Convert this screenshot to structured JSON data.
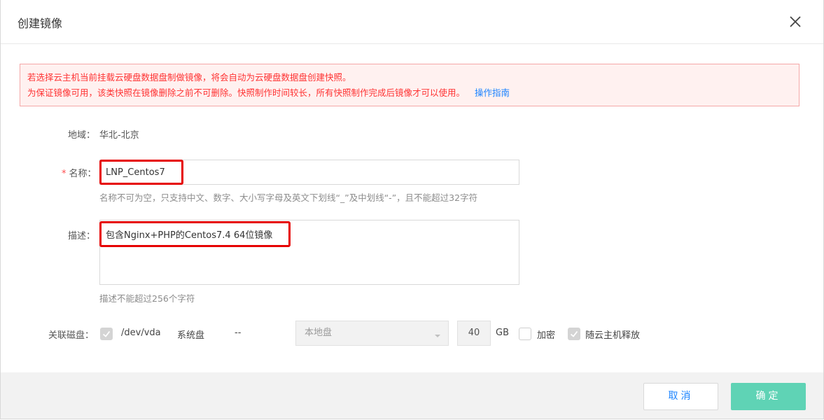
{
  "dialog": {
    "title": "创建镜像",
    "close_icon": "close-icon"
  },
  "alert": {
    "line1": "若选择云主机当前挂载云硬盘数据盘制做镜像，将会自动为云硬盘数据盘创建快照。",
    "line2": "为保证镜像可用，该类快照在镜像删除之前不可删除。快照制作时间较长，所有快照制作完成后镜像才可以使用。",
    "link": "操作指南",
    "text_color": "#ff3333",
    "link_color": "#1b83ff"
  },
  "form": {
    "region": {
      "label": "地域：",
      "value": "华北-北京"
    },
    "name": {
      "required_mark": "*",
      "label": "名称：",
      "value": "LNP_Centos7",
      "hint": "名称不可为空，只支持中文、数字、大小写字母及英文下划线“_”及中划线“-”，且不能超过32字符"
    },
    "description": {
      "label": "描述：",
      "value": "包含Nginx+PHP的Centos7.4 64位镜像",
      "hint": "描述不能超过256个字符"
    },
    "disk": {
      "label": "关联磁盘：",
      "selected": true,
      "device": "/dev/vda",
      "type": "系统盘",
      "separator": "--",
      "storage": "本地盘",
      "size": "40",
      "unit": "GB",
      "encrypt_label": "加密",
      "encrypt_checked": false,
      "release_label": "随云主机释放",
      "release_checked": true
    }
  },
  "footer": {
    "cancel_label": "取消",
    "ok_label": "确定",
    "ok_color": "#5fd3b5"
  }
}
